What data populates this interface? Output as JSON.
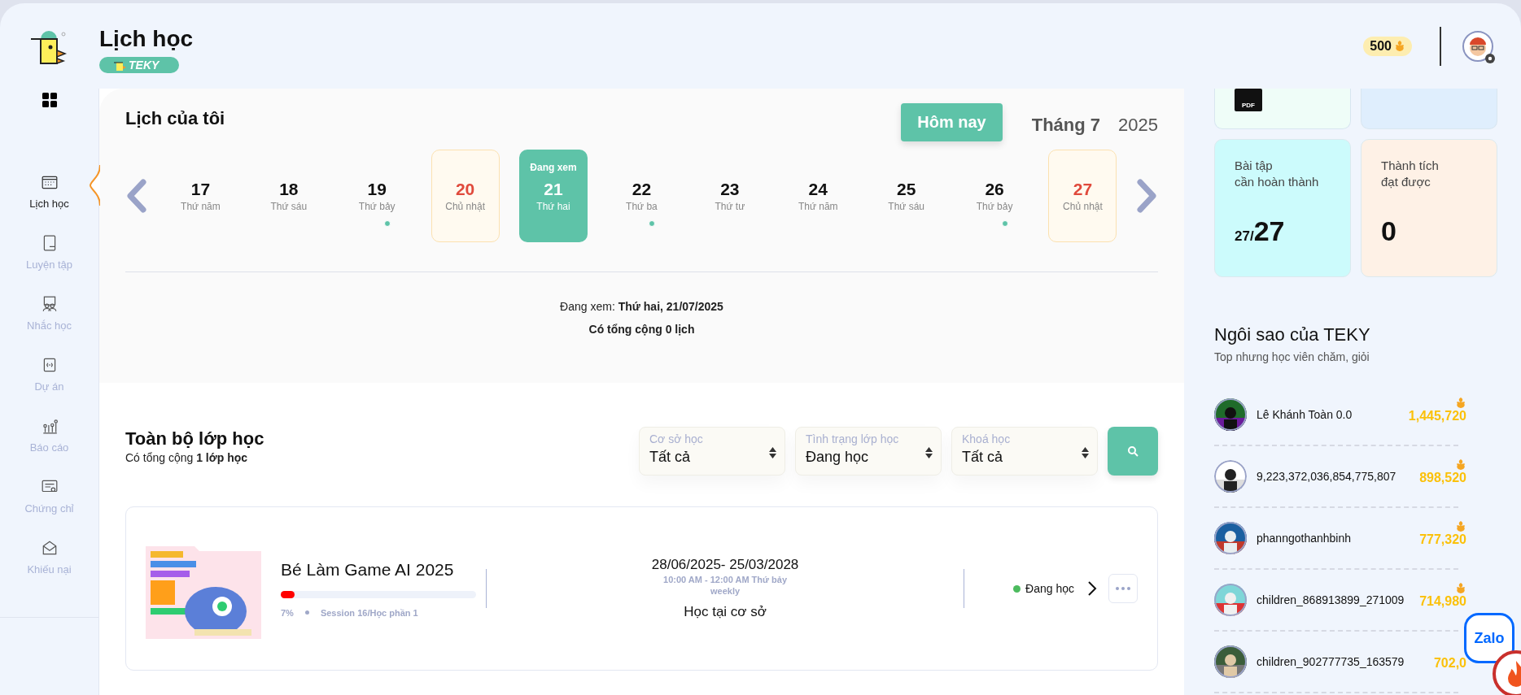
{
  "header": {
    "title": "Lịch học",
    "badge": "TEKY",
    "coins": "500"
  },
  "sidebar": {
    "items": [
      {
        "label": "Lịch học",
        "kind": "calendar",
        "selected": true
      },
      {
        "label": "Luyện tập",
        "kind": "practice",
        "selected": false
      },
      {
        "label": "Nhắc học",
        "kind": "remind",
        "selected": false
      },
      {
        "label": "Dự án",
        "kind": "project",
        "selected": false
      },
      {
        "label": "Báo cáo",
        "kind": "report",
        "selected": false
      },
      {
        "label": "Chứng chỉ",
        "kind": "certificate",
        "selected": false
      },
      {
        "label": "Khiếu nại",
        "kind": "complaint",
        "selected": false
      }
    ]
  },
  "calendar": {
    "title": "Lịch của tôi",
    "today_button": "Hôm nay",
    "month": "Tháng 7",
    "year": "2025",
    "days": [
      {
        "date": "17",
        "weekday": "Thứ năm",
        "weekend": false,
        "selected": false,
        "has_event": false
      },
      {
        "date": "18",
        "weekday": "Thứ sáu",
        "weekend": false,
        "selected": false,
        "has_event": false
      },
      {
        "date": "19",
        "weekday": "Thứ bảy",
        "weekend": false,
        "selected": false,
        "has_event": true
      },
      {
        "date": "20",
        "weekday": "Chủ nhật",
        "weekend": true,
        "selected": false,
        "has_event": false
      },
      {
        "date": "21",
        "weekday": "Thứ hai",
        "weekend": false,
        "selected": true,
        "has_event": false,
        "tag": "Đang xem"
      },
      {
        "date": "22",
        "weekday": "Thứ ba",
        "weekend": false,
        "selected": false,
        "has_event": true
      },
      {
        "date": "23",
        "weekday": "Thứ tư",
        "weekend": false,
        "selected": false,
        "has_event": false
      },
      {
        "date": "24",
        "weekday": "Thứ năm",
        "weekend": false,
        "selected": false,
        "has_event": false
      },
      {
        "date": "25",
        "weekday": "Thứ sáu",
        "weekend": false,
        "selected": false,
        "has_event": false
      },
      {
        "date": "26",
        "weekday": "Thứ bảy",
        "weekend": false,
        "selected": false,
        "has_event": true
      },
      {
        "date": "27",
        "weekday": "Chủ nhật",
        "weekend": true,
        "selected": false,
        "has_event": false
      }
    ],
    "viewing": "Đang xem: **Thứ hai, 21/07/2025**",
    "total": "Có tổng cộng 0 lịch"
  },
  "classes": {
    "title": "Toàn bộ lớp học",
    "count": "Có tổng cộng **1 lớp học**",
    "filters": [
      {
        "label": "Cơ sở học",
        "value": "Tất cả"
      },
      {
        "label": "Tình trạng lớp học",
        "value": "Đang học"
      },
      {
        "label": "Khoá học",
        "value": "Tất cả"
      }
    ],
    "items": [
      {
        "name": "Bé Làm Game AI 2025",
        "level": 0.07,
        "percent": "7%",
        "session": "Session 16/Học phần 1",
        "dates": "28/06/2025- 25/03/2028",
        "time": "10:00 AM - 12:00 AM Thứ bảy",
        "repeat": "weekly",
        "mode": "Học tại cơ sở",
        "status": "Đang học",
        "color": "#4cbb5e"
      }
    ]
  },
  "stats": {
    "top_cards": [
      {
        "kind": "pdf",
        "icon_label": "PDF",
        "color": "#effdf8"
      },
      {
        "kind": "blank",
        "color": "#dfeefd"
      }
    ],
    "cards": [
      {
        "title": "Bài tập\ncần hoàn thành",
        "value_small": "27/",
        "value": "27",
        "color": "#ccfbfc"
      },
      {
        "title": "Thành tích\nđạt được",
        "value": "0",
        "color": "#fef1e6"
      }
    ]
  },
  "leaderboard": {
    "title": "Ngôi sao của TEKY",
    "subtitle": "Top nhưng học viên chăm, giỏi",
    "rows": [
      {
        "name": "Lê Khánh Toàn 0.0",
        "score": "1,445,720",
        "icon": true
      },
      {
        "name": "9,223,372,036,854,775,807",
        "score": "898,520",
        "icon": true
      },
      {
        "name": "phanngothanhbinh",
        "score": "777,320",
        "icon": true
      },
      {
        "name": "children_868913899_271009",
        "score": "714,980",
        "icon": true
      },
      {
        "name": "children_902777735_163579",
        "score": "702,0",
        "icon": false
      }
    ]
  },
  "zalo": "Zalo"
}
